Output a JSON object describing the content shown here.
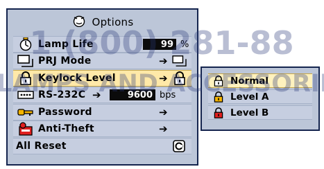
{
  "menu": {
    "title": "Options",
    "items": [
      {
        "label": "Lamp Life",
        "value": "99",
        "unit": "%"
      },
      {
        "label": "PRJ Mode"
      },
      {
        "label": "Keylock Level"
      },
      {
        "label": "RS-232C",
        "value": "9600",
        "unit": "bps"
      },
      {
        "label": "Password"
      },
      {
        "label": "Anti-Theft"
      },
      {
        "label": "All Reset"
      }
    ],
    "arrow": "➔"
  },
  "submenu": {
    "items": [
      {
        "label": "Normal"
      },
      {
        "label": "Level A"
      },
      {
        "label": "Level B"
      }
    ]
  },
  "watermark": {
    "line1": "1 (800) 281-88",
    "line2": "R LAMPS AND ACCESSORIES"
  },
  "colors": {
    "panel_bg": "#bcc6d8",
    "panel_border": "#14244e",
    "selected_bg": "#ffe9a8",
    "watermark": "#2a3a7a"
  }
}
